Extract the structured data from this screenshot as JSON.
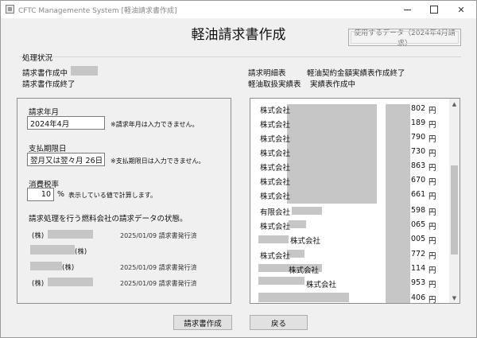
{
  "window": {
    "title": "CFTC Managemente System  [軽油請求書作成]"
  },
  "header": {
    "title": "軽油請求書作成",
    "data_button": "使用するデータ（2024年4月請求）"
  },
  "status": {
    "legend": "処理状況",
    "items": [
      "請求書作成中",
      "請求書作成終了",
      "請求明細表",
      "軽油契約金額実績表作成終了",
      "軽油取扱実績表",
      "実績表作成中"
    ]
  },
  "form": {
    "billing_month_label": "請求年月",
    "billing_month_value": "2024年4月",
    "billing_month_note": "※請求年月は入力できません。",
    "due_date_label": "支払期限日",
    "due_date_value": "翌月又は翌々月  26日",
    "due_date_note": "※支払期限日は入力できません。",
    "tax_label": "消費税率",
    "tax_value": "10",
    "tax_unit": "%",
    "tax_note": "表示している値で計算します。",
    "companies_heading": "請求処理を行う燃料会社の請求データの状態。",
    "companies": [
      {
        "name_prefix": "(株)",
        "name_suffix": "",
        "status": "2025/01/09 請求書発行済"
      },
      {
        "name_prefix": "",
        "name_suffix": "(株)",
        "status": ""
      },
      {
        "name_prefix": "",
        "name_suffix": "(株)",
        "status": "2025/01/09 請求書発行済"
      },
      {
        "name_prefix": "(株)",
        "name_suffix": "",
        "status": "2025/01/09 請求書発行済"
      }
    ]
  },
  "list": {
    "rows": [
      {
        "name": "株式会社",
        "amount": "802",
        "unit": "円"
      },
      {
        "name": "株式会社",
        "amount": "189",
        "unit": "円"
      },
      {
        "name": "株式会社",
        "amount": "790",
        "unit": "円"
      },
      {
        "name": "株式会社",
        "amount": "730",
        "unit": "円"
      },
      {
        "name": "株式会社",
        "amount": "863",
        "unit": "円"
      },
      {
        "name": "株式会社",
        "amount": "670",
        "unit": "円"
      },
      {
        "name": "株式会社",
        "amount": "661",
        "unit": "円"
      },
      {
        "name": "有限会社",
        "amount": "598",
        "unit": "円"
      },
      {
        "name": "株式会社",
        "amount": "065",
        "unit": "円"
      },
      {
        "name": "株式会社",
        "amount": "005",
        "unit": "円"
      },
      {
        "name": "株式会社",
        "amount": "772",
        "unit": "円"
      },
      {
        "name": "株式会社",
        "amount": "114",
        "unit": "円"
      },
      {
        "name": "株式会社",
        "amount": "953",
        "unit": "円"
      },
      {
        "name": "",
        "amount": "406",
        "unit": "円"
      }
    ]
  },
  "footer": {
    "create_button": "請求書作成",
    "back_button": "戻る"
  }
}
